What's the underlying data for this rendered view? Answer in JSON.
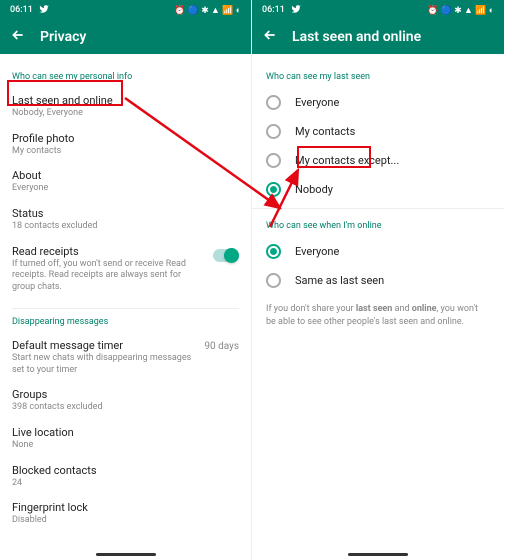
{
  "status": {
    "time": "06:11",
    "icons": "⏰ 🔵 ✱ ▲ 📶 ◐"
  },
  "left": {
    "title": "Privacy",
    "sec1": "Who can see my personal info",
    "last_seen": {
      "t": "Last seen and online",
      "s": "Nobody, Everyone"
    },
    "profile_photo": {
      "t": "Profile photo",
      "s": "My contacts"
    },
    "about": {
      "t": "About",
      "s": "Everyone"
    },
    "status": {
      "t": "Status",
      "s": "18 contacts excluded"
    },
    "read_receipts": {
      "t": "Read receipts",
      "s": "If turned off, you won't send or receive Read receipts. Read receipts are always sent for group chats."
    },
    "sec2": "Disappearing messages",
    "default_timer": {
      "t": "Default message timer",
      "s": "Start new chats with disappearing messages set to your timer",
      "v": "90 days"
    },
    "groups": {
      "t": "Groups",
      "s": "398 contacts excluded"
    },
    "live_location": {
      "t": "Live location",
      "s": "None"
    },
    "blocked": {
      "t": "Blocked contacts",
      "s": "24"
    },
    "fingerprint": {
      "t": "Fingerprint lock",
      "s": "Disabled"
    }
  },
  "right": {
    "title": "Last seen and online",
    "sec1": "Who can see my last seen",
    "opts1": {
      "a": "Everyone",
      "b": "My contacts",
      "c": "My contacts except...",
      "d": "Nobody"
    },
    "sec2": "Who can see when I'm online",
    "opts2": {
      "a": "Everyone",
      "b": "Same as last seen"
    },
    "note_pre": "If you don't share your ",
    "note_b1": "last seen",
    "note_mid": " and ",
    "note_b2": "online",
    "note_post": ", you won't be able to see other people's last seen and online."
  }
}
